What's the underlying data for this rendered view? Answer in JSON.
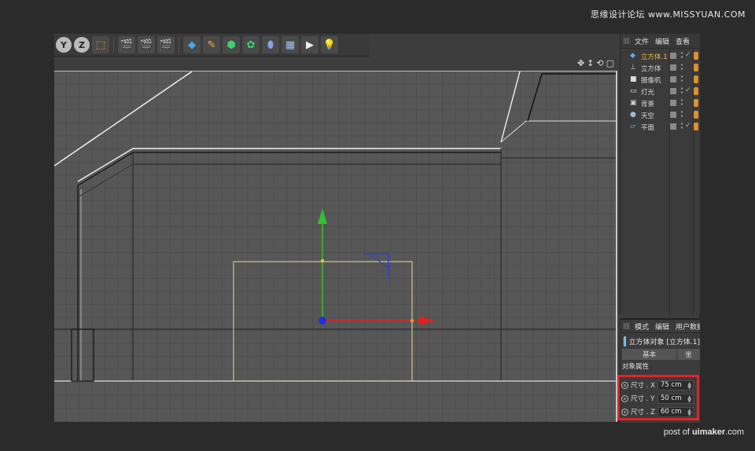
{
  "watermark": "思缘设计论坛 www.MISSYUAN.COM",
  "footer": {
    "prefix": "post of",
    "brand": "uimaker",
    "suffix": ".com"
  },
  "toolbar": {
    "axes": [
      "Y",
      "Z"
    ],
    "icons": [
      "coordinate-system-icon",
      "render-view-icon",
      "render-picture-queue-icon",
      "render-settings-icon",
      "cube-primitive-icon",
      "pen-spline-icon",
      "subdivision-surface-icon",
      "cloner-icon",
      "deformer-icon",
      "floor-grid-icon",
      "camera-icon",
      "light-bulb-icon"
    ]
  },
  "viewport": {
    "nav_icons": [
      "✥",
      "↕",
      "⟲",
      "▢"
    ]
  },
  "object_manager": {
    "menu": [
      "文件",
      "编辑",
      "查看"
    ],
    "objects": [
      {
        "name": "立方体.1",
        "icon": "◆",
        "icon_color": "#5fb0e8",
        "selected": true,
        "check": true
      },
      {
        "name": "立方体",
        "icon": "⊥",
        "icon_color": "#bcd0e8",
        "selected": false,
        "check": false
      },
      {
        "name": "摄像机",
        "icon": "■",
        "icon_color": "#dddddd",
        "selected": false,
        "check": false
      },
      {
        "name": "灯光",
        "icon": "▭",
        "icon_color": "#eeeeee",
        "selected": false,
        "check": true
      },
      {
        "name": "背景",
        "icon": "▣",
        "icon_color": "#cfcfcf",
        "selected": false,
        "check": false
      },
      {
        "name": "天空",
        "icon": "●",
        "icon_color": "#9fb8d8",
        "selected": false,
        "check": false
      },
      {
        "name": "平面",
        "icon": "▱",
        "icon_color": "#7fb0e0",
        "selected": false,
        "check": true
      }
    ]
  },
  "attribute_manager": {
    "menu": [
      "模式",
      "编辑",
      "用户数据"
    ],
    "object_title": "立方体对象 [立方体.1]",
    "tabs": [
      "基本",
      "坐"
    ],
    "section_title": "对象属性",
    "params": [
      {
        "label": "尺寸 . X",
        "value": "75 cm"
      },
      {
        "label": "尺寸 . Y",
        "value": "50 cm"
      },
      {
        "label": "尺寸 . Z",
        "value": "60 cm"
      }
    ]
  },
  "colors": {
    "highlight_box": "#e0242a",
    "selected_object": "#f0b840",
    "axis_x": "#e02020",
    "axis_y": "#30c030",
    "axis_z": "#2040e0"
  }
}
